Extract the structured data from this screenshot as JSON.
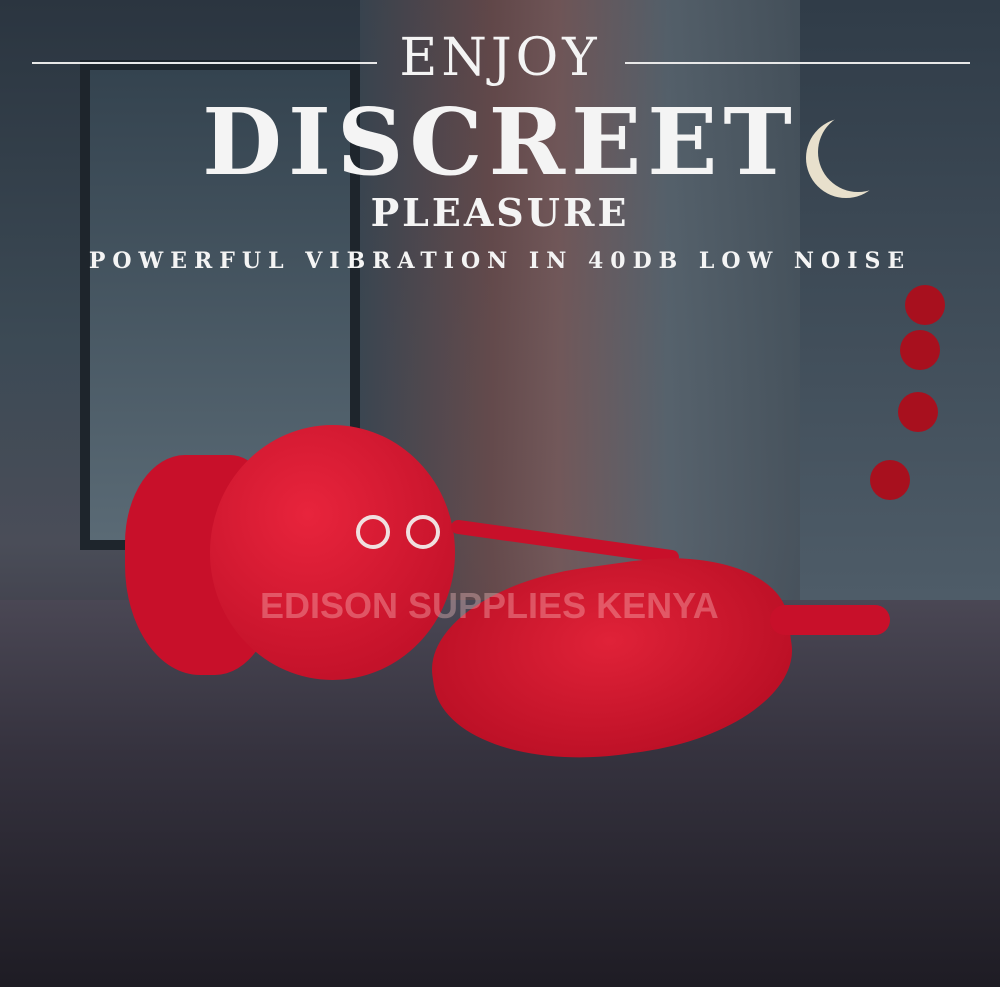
{
  "headline": {
    "line1": "ENJOY",
    "line2": "DISCREET",
    "line3": "PLEASURE"
  },
  "subtitle": "POWERFUL VIBRATION IN 40DB LOW NOISE",
  "watermark": "EDISON SUPPLIES KENYA",
  "colors": {
    "product": "#c8102a",
    "text": "#f4f4f4"
  }
}
